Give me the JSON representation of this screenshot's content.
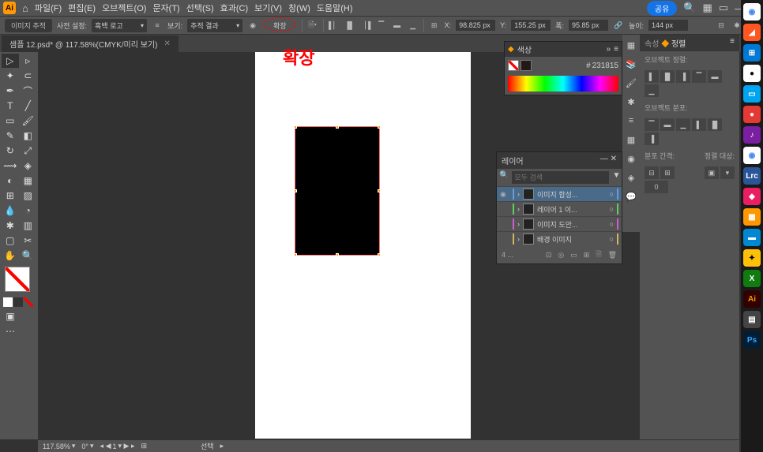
{
  "app": {
    "logo": "Ai",
    "menu": [
      "파일(F)",
      "편집(E)",
      "오브젝트(O)",
      "문자(T)",
      "선택(S)",
      "효과(C)",
      "보기(V)",
      "창(W)",
      "도움말(H)"
    ],
    "share": "공유"
  },
  "control": {
    "trace_label": "이미지 추적",
    "preset_label": "사전 설정:",
    "preset_value": "흑백 로고",
    "view_label": "보기:",
    "view_value": "추적 결과",
    "expand": "확장",
    "x_label": "X:",
    "x_value": "98.825 px",
    "y_label": "Y:",
    "y_value": "155.25 px",
    "w_label": "폭:",
    "w_value": "95.85 px",
    "h_label": "높이:",
    "h_value": "144 px"
  },
  "annotation": "확장",
  "tab": {
    "name": "샘플 12.psd* @ 117.58%(CMYK/미리 보기)"
  },
  "color_panel": {
    "title": "색상",
    "hex": "231815"
  },
  "layers": {
    "title": "레이어",
    "search_placeholder": "모두 검색",
    "items": [
      {
        "name": "이미지 합성...",
        "color": "#6b9bd1",
        "selected": true,
        "visible": true
      },
      {
        "name": "레이어 1 이...",
        "color": "#5dd15d",
        "selected": false,
        "visible": false
      },
      {
        "name": "이미지 도안...",
        "color": "#d15dd1",
        "selected": false,
        "visible": false
      },
      {
        "name": "배경 이미지",
        "color": "#d1b65d",
        "selected": false,
        "visible": false
      }
    ],
    "count": "4 ..."
  },
  "props": {
    "tab1": "속성",
    "tab2": "정렬",
    "section1": "오브젝트 정렬:",
    "section2": "오브젝트 분포:",
    "section3": "분포 간격:",
    "section4": "정렬 대상:"
  },
  "status": {
    "zoom": "117.58%",
    "angle": "0°",
    "nav": "1",
    "mode": "선택"
  },
  "taskbar_apps": [
    {
      "bg": "#fff",
      "fg": "#4285f4",
      "text": "◉"
    },
    {
      "bg": "#ff5722",
      "fg": "#fff",
      "text": "◢"
    },
    {
      "bg": "#0078d4",
      "fg": "#fff",
      "text": "⊞"
    },
    {
      "bg": "#fff",
      "fg": "#000",
      "text": "●"
    },
    {
      "bg": "#00a4ef",
      "fg": "#fff",
      "text": "▭"
    },
    {
      "bg": "#e53935",
      "fg": "#fff",
      "text": "●"
    },
    {
      "bg": "#7b1fa2",
      "fg": "#fff",
      "text": "♪"
    },
    {
      "bg": "#fff",
      "fg": "#4285f4",
      "text": "◉"
    },
    {
      "bg": "#2a5699",
      "fg": "#fff",
      "text": "Lrc"
    },
    {
      "bg": "#e91e63",
      "fg": "#fff",
      "text": "◆"
    },
    {
      "bg": "#ff9800",
      "fg": "#fff",
      "text": "▦"
    },
    {
      "bg": "#0288d1",
      "fg": "#fff",
      "text": "▬"
    },
    {
      "bg": "#ffc107",
      "fg": "#000",
      "text": "✦"
    },
    {
      "bg": "#107c10",
      "fg": "#fff",
      "text": "X"
    },
    {
      "bg": "#330000",
      "fg": "#ff9a00",
      "text": "Ai"
    },
    {
      "bg": "#444",
      "fg": "#fff",
      "text": "▤"
    },
    {
      "bg": "#001e36",
      "fg": "#31a8ff",
      "text": "Ps"
    }
  ]
}
